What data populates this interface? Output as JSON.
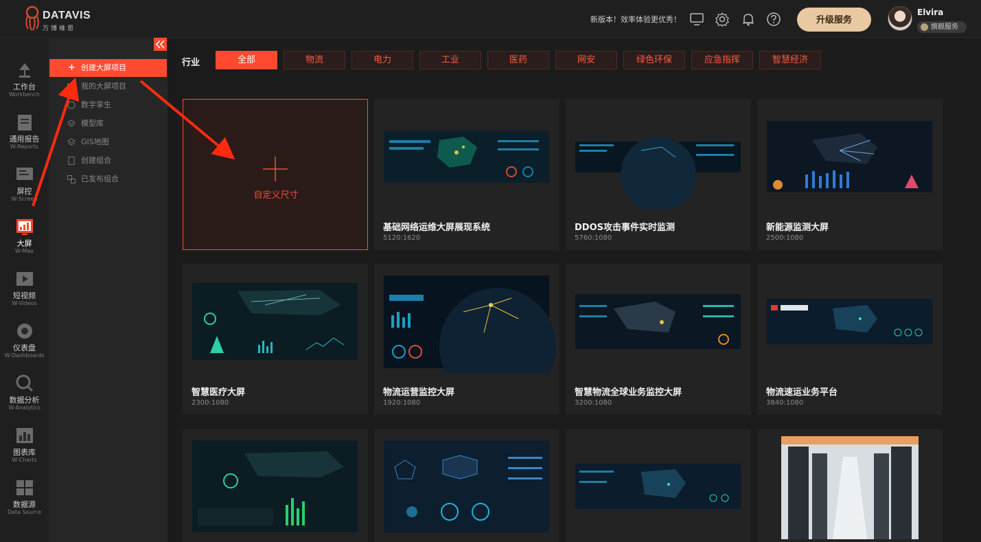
{
  "brand": {
    "name": "DATAVIS",
    "sub": "万博维思"
  },
  "header": {
    "notice": "新版本！效率体验更优秀！",
    "upgrade_label": "升级服务",
    "user": {
      "name": "Elvira",
      "badge": "旗舰服务"
    },
    "icons": [
      "monitor-icon",
      "settings-icon",
      "bell-icon",
      "help-icon"
    ]
  },
  "rail": [
    {
      "id": "workbench",
      "label": "工作台",
      "sub": "Workbench"
    },
    {
      "id": "reports",
      "label": "通用报告",
      "sub": "W-Reports"
    },
    {
      "id": "screen",
      "label": "屏控",
      "sub": "W-Screen"
    },
    {
      "id": "max",
      "label": "大屏",
      "sub": "W-Max",
      "active": true
    },
    {
      "id": "videos",
      "label": "短视频",
      "sub": "W-Videos"
    },
    {
      "id": "dashboards",
      "label": "仪表盘",
      "sub": "W-Dashboards"
    },
    {
      "id": "analytics",
      "label": "数据分析",
      "sub": "W-Analytics"
    },
    {
      "id": "charts",
      "label": "图表库",
      "sub": "W-Charts"
    },
    {
      "id": "datasource",
      "label": "数据源",
      "sub": "Data Source"
    }
  ],
  "submenu": [
    {
      "id": "create",
      "label": "创建大屏项目",
      "active": true
    },
    {
      "id": "my",
      "label": "我的大屏项目"
    },
    {
      "id": "twin",
      "label": "数字孪生"
    },
    {
      "id": "models",
      "label": "模型库"
    },
    {
      "id": "gis",
      "label": "GIS地图"
    },
    {
      "id": "combo",
      "label": "创建组合"
    },
    {
      "id": "published",
      "label": "已发布组合"
    }
  ],
  "filter": {
    "label": "行业",
    "chips": [
      "全部",
      "物流",
      "电力",
      "工业",
      "医药",
      "网安",
      "绿色环保",
      "应急指挥",
      "智慧经济"
    ],
    "active_index": 0
  },
  "create_card": {
    "label": "自定义尺寸"
  },
  "templates": [
    {
      "title": "基础网络运维大屏展现系统",
      "size": "5120:1620"
    },
    {
      "title": "DDOS攻击事件实时监测",
      "size": "5760:1080"
    },
    {
      "title": "新能源监测大屏",
      "size": "2500:1080"
    },
    {
      "title": "智慧医疗大屏",
      "size": "2300:1080"
    },
    {
      "title": "物流运营监控大屏",
      "size": "1920:1080"
    },
    {
      "title": "智慧物流全球业务监控大屏",
      "size": "3200:1080"
    },
    {
      "title": "物流速运业务平台",
      "size": "3840:1080"
    },
    {
      "title": "",
      "size": ""
    },
    {
      "title": "",
      "size": ""
    },
    {
      "title": "",
      "size": ""
    },
    {
      "title": "",
      "size": ""
    }
  ],
  "colors": {
    "accent": "#ff4a2f",
    "upgrade": "#e9c9a1",
    "bg": "#1b1b1b"
  }
}
